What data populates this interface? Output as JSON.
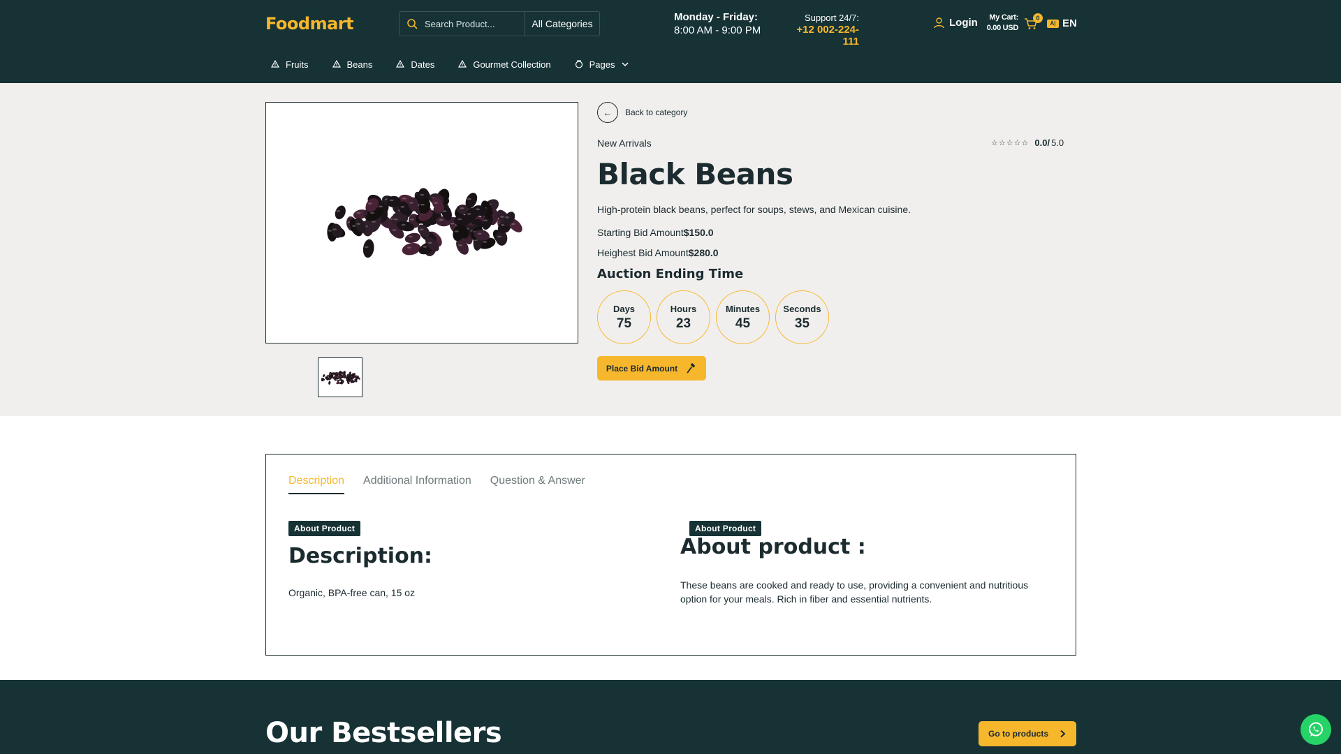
{
  "header": {
    "logo": "Foodmart",
    "search_placeholder": "Search Product...",
    "category": "All Categories",
    "hours_line1": "Monday - Friday:",
    "hours_line2": "8:00 AM - 9:00 PM",
    "support_label": "Support 24/7:",
    "support_phone": "+12 002-224-111",
    "login_label": "Login",
    "cart_label": "My Cart:",
    "cart_total": "0.00 USD",
    "cart_count": "0",
    "language": "EN"
  },
  "nav": {
    "items": [
      "Fruits",
      "Beans",
      "Dates",
      "Gourmet Collection"
    ],
    "pages_label": "Pages"
  },
  "product": {
    "back_label": "Back to category",
    "category": "New Arrivals",
    "rating_value": "0.0",
    "rating_separator": "/",
    "rating_max": "5.0",
    "stars_filled": 0,
    "title": "Black Beans",
    "description": "High-protein black beans, perfect for soups, stews, and Mexican cuisine.",
    "starting_bid_label": "Starting Bid Amount",
    "starting_bid_value": "$150.0",
    "highest_bid_label": "Heighest Bid Amount",
    "highest_bid_value": "$280.0",
    "auction_title": "Auction Ending Time",
    "countdown": {
      "days_label": "Days",
      "days": "75",
      "hours_label": "Hours",
      "hours": "23",
      "minutes_label": "Minutes",
      "minutes": "45",
      "seconds_label": "Seconds",
      "seconds": "35"
    },
    "bid_button": "Place Bid Amount"
  },
  "tabs": {
    "items": [
      "Description",
      "Additional Information",
      "Question & Answer"
    ],
    "active": "Description",
    "about_pill": "About Product",
    "description_heading": "Description:",
    "description_text": "Organic, BPA-free can, 15 oz",
    "about_heading": "About product :",
    "about_text": "These beans are cooked and ready to use, providing a convenient and nutritious option for your meals. Rich in fiber and essential nutrients."
  },
  "bestsellers": {
    "title": "Our Bestsellers",
    "button": "Go to products"
  },
  "colors": {
    "primary_dark": "#163235",
    "accent": "#f6b72c",
    "page_bg": "#f1efed",
    "whatsapp": "#25d366"
  }
}
